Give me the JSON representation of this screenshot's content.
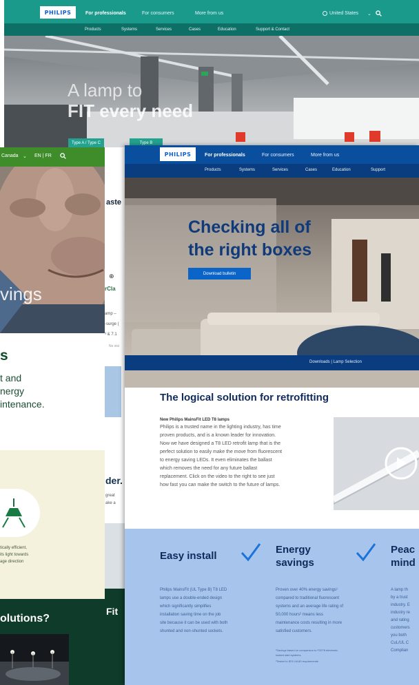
{
  "back_page": {
    "logo": "PHILIPS",
    "nav": [
      "For professionals",
      "For consumers",
      "More from us"
    ],
    "region": "United States",
    "subnav": [
      "Products",
      "Systems",
      "Services",
      "Cases",
      "Education",
      "Support & Contact"
    ],
    "hero_line1": "A lamp to",
    "hero_line2": "FIT every need",
    "buttons": [
      "Type A / Type C",
      "Type B"
    ]
  },
  "left_page": {
    "region": "Canada",
    "lang": "EN | FR",
    "hero_word": "vings",
    "heading": "s",
    "lead_lines": [
      "t and",
      "nergy",
      "intenance."
    ],
    "small_lines": [
      "tically efficient,",
      "its light towards",
      "age direction"
    ],
    "question": "olutions?"
  },
  "strip": {
    "texts": [
      "aste",
      "rCla",
      "amp –",
      "-surge (",
      "³ & 7.1",
      "No visi",
      "der.",
      "great",
      "ake a ",
      "Fit"
    ]
  },
  "front_page": {
    "logo": "PHILIPS",
    "nav": [
      "For professionals",
      "For consumers",
      "More from us"
    ],
    "subnav": [
      "Products",
      "Systems",
      "Services",
      "Cases",
      "Education",
      "Support"
    ],
    "hero_line1": "Checking all of",
    "hero_line2": "the right boxes",
    "download_button": "Download bulletin",
    "linkbar": "Downloads | Lamp Selection",
    "section_title": "The logical solution for retrofitting",
    "body_heading": "New Philips MainsFit LED T8 lamps",
    "body_lines": [
      "Philips is a trusted name in the lighting industry, has time",
      "proven products, and is a known leader for innovation.",
      "Now we have designed a T8 LED retrofit lamp that is the",
      "perfect solution to easily make the move from fluorescent",
      "to energy saving LEDs. It even eliminates the ballast",
      "which removes the need for any future ballast",
      "replacement. Click on the video to the right to see just",
      "how fast you can make the switch to the future of lamps."
    ],
    "features": [
      {
        "title_lines": [
          "Easy install"
        ],
        "lines": [
          "Philips MainsFit (UL Type B) T8 LED",
          "lamps use a double-ended design",
          "which significantly simplifies",
          "installation saving time on the job",
          "site because it can be used with both",
          "shunted and non-shunted sockets."
        ],
        "notes": []
      },
      {
        "title_lines": [
          "Energy",
          "savings"
        ],
        "lines": [
          "Proven over 40% energy savings¹",
          "compared to traditional fluorescent",
          "systems and an average life rating of",
          "50,000 hours² means less",
          "maintenance costs resulting in more",
          "satisfied customers."
        ],
        "notes": [
          "¹Savings based on comparison to F32T8 electronic",
          "instant start systems",
          "²Tested to IES LM-80 requirements"
        ]
      },
      {
        "title_lines": [
          "Peac",
          "mind"
        ],
        "lines": [
          "A lamp th",
          "by a trust",
          "industry. E",
          "industry re",
          "and rating",
          "customers",
          "you both",
          "CuL/UL C",
          "Complian"
        ],
        "notes": []
      }
    ]
  },
  "colors": {
    "teal": "#0d8a7c",
    "green": "#3f8d2a",
    "blue": "#0a4e9e",
    "navy": "#0f2a5a",
    "light_blue": "#a7c4ec",
    "check": "#1a73d9"
  }
}
